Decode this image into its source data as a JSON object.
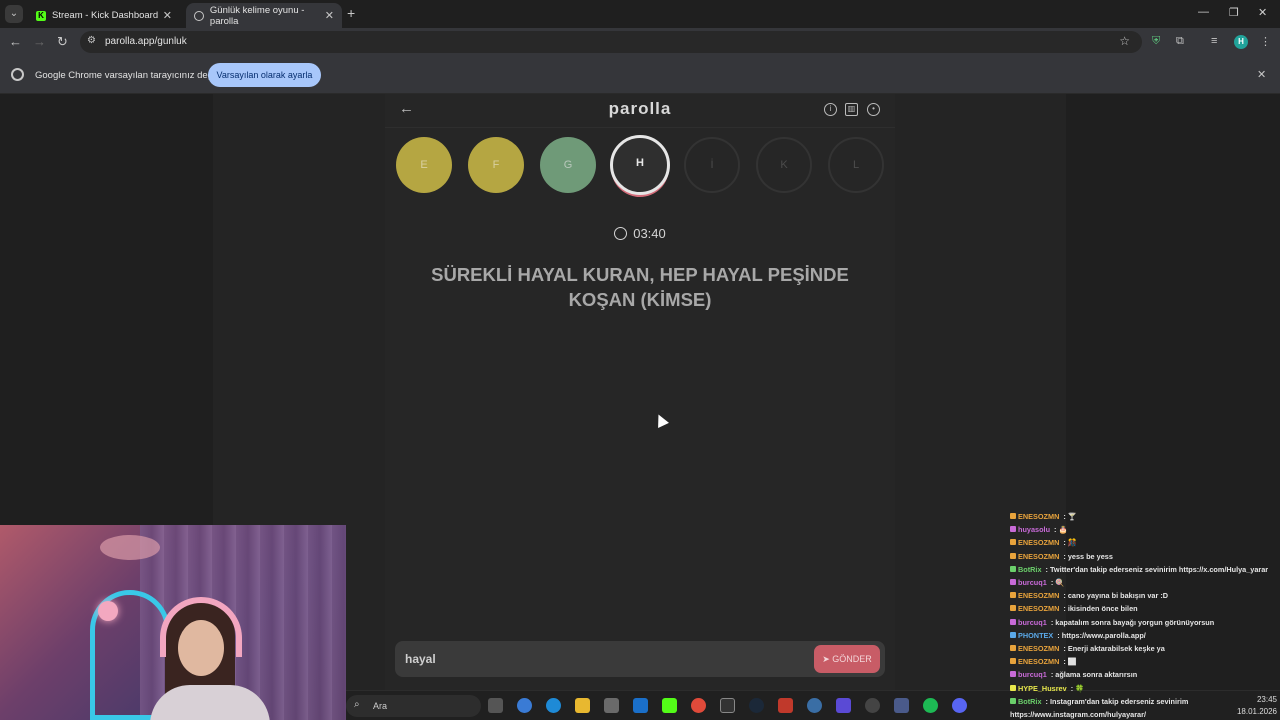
{
  "browser": {
    "tabs": [
      {
        "title": "Stream - Kick Dashboard",
        "favicon": "K"
      },
      {
        "title": "Günlük kelime oyunu - parolla",
        "favicon": "globe"
      }
    ],
    "url": "parolla.app/gunluk",
    "profile_initial": "H",
    "infobar": {
      "message": "Google Chrome varsayılan tarayıcınız değil",
      "button": "Varsayılan olarak ayarla"
    }
  },
  "app": {
    "logo": "parolla",
    "letters": [
      {
        "letter": "E",
        "state": "answered"
      },
      {
        "letter": "F",
        "state": "answered"
      },
      {
        "letter": "G",
        "state": "correct"
      },
      {
        "letter": "H",
        "state": "current"
      },
      {
        "letter": "İ",
        "state": "pending"
      },
      {
        "letter": "K",
        "state": "pending"
      },
      {
        "letter": "L",
        "state": "pending"
      }
    ],
    "timer": "03:40",
    "question": "SÜREKLİ HAYAL KURAN, HEP HAYAL PEŞİNDE KOŞAN (KİMSE)",
    "answer_value": "hayal",
    "send_label": "GÖNDER",
    "colors": {
      "answered": "#b5a642",
      "correct": "#6f9a78",
      "accent": "#c85c66"
    }
  },
  "taskbar": {
    "search_label": "Ara",
    "time": "23:45",
    "date": "18.01.2026"
  },
  "chat": [
    {
      "user": "ENESOZMN",
      "color": "#e8a33c",
      "text": " : 🍸"
    },
    {
      "user": "huyasolu",
      "color": "#c86ad8",
      "text": " : 🎂"
    },
    {
      "user": "ENESOZMN",
      "color": "#e8a33c",
      "text": " : 🎊"
    },
    {
      "user": "ENESOZMN",
      "color": "#e8a33c",
      "text": " : yess be yess"
    },
    {
      "user": "BotRix",
      "color": "#6bd06b",
      "text": " : Twitter'dan takip ederseniz sevinirim https://x.com/Hulya_yarar"
    },
    {
      "user": "burcuq1",
      "color": "#c86ad8",
      "text": " : 🍭"
    },
    {
      "user": "ENESOZMN",
      "color": "#e8a33c",
      "text": " : cano yayına bi bakışın var :D"
    },
    {
      "user": "ENESOZMN",
      "color": "#e8a33c",
      "text": " : ikisinden önce bilen"
    },
    {
      "user": "burcuq1",
      "color": "#c86ad8",
      "text": " : kapatalım sonra bayağı yorgun görünüyorsun"
    },
    {
      "user": "PHONTEX",
      "color": "#5aa8e8",
      "text": " : https://www.parolla.app/"
    },
    {
      "user": "ENESOZMN",
      "color": "#e8a33c",
      "text": " : Enerji aktarabilsek keşke ya"
    },
    {
      "user": "ENESOZMN",
      "color": "#e8a33c",
      "text": " : ⬜"
    },
    {
      "user": "burcuq1",
      "color": "#c86ad8",
      "text": " : ağlama sonra aktarırsın"
    },
    {
      "user": "HYPE_Husrev",
      "color": "#e8e84c",
      "text": " : 🍀"
    },
    {
      "user": "BotRix",
      "color": "#6bd06b",
      "text": " : Instagram'dan takip ederseniz sevinirim"
    },
    {
      "user": "",
      "color": "#e6e6e6",
      "text": "https://www.instagram.com/hulyayarar/"
    }
  ]
}
